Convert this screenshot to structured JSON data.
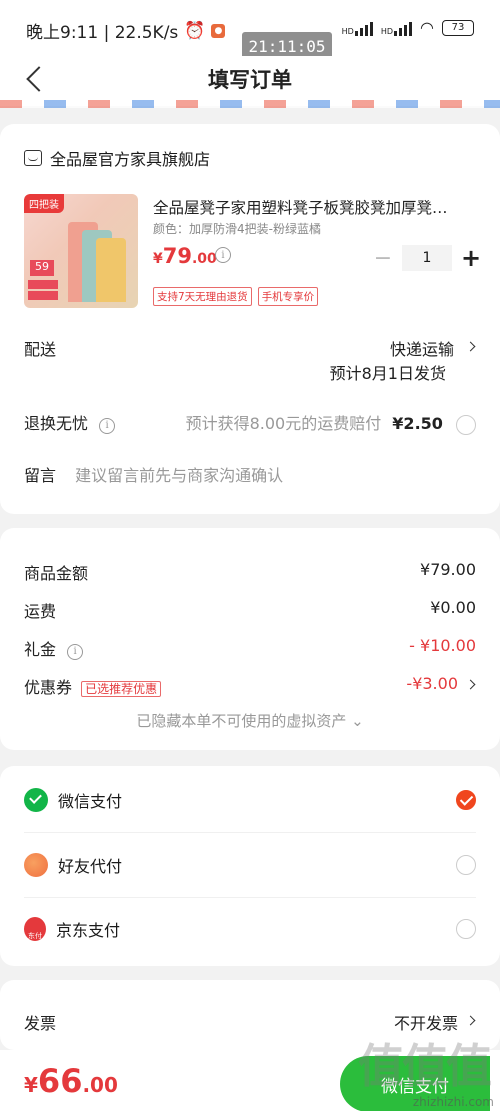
{
  "status_bar": {
    "time_speed": "晚上9:11 | 22.5K/s",
    "overlay_time": "21:11:05",
    "battery": "73",
    "net1": "HD",
    "net2": "HD"
  },
  "header": {
    "title": "填写订单"
  },
  "shop": {
    "name": "全品屋官方家具旗舰店"
  },
  "product": {
    "image_tag": "四把装",
    "image_price": "59",
    "name": "全品屋凳子家用塑料凳子板凳胶凳加厚凳…",
    "spec": "颜色：加厚防滑4把装-粉绿蓝橘",
    "price_currency": "¥",
    "price_int": "79",
    "price_dec": ".00",
    "quantity": "1",
    "tags": [
      "支持7天无理由退货",
      "手机专享价"
    ]
  },
  "delivery": {
    "label": "配送",
    "method": "快递运输",
    "estimate": "预计8月1日发货"
  },
  "return_worry_free": {
    "label": "退换无忧",
    "desc": "预计获得8.00元的运费赔付",
    "price": "¥2.50"
  },
  "message": {
    "label": "留言",
    "placeholder": "建议留言前先与商家沟通确认"
  },
  "summary": {
    "goods_label": "商品金额",
    "goods_value": "¥79.00",
    "shipping_label": "运费",
    "shipping_value": "¥0.00",
    "gift_label": "礼金",
    "gift_value": "- ¥10.00",
    "coupon_label": "优惠券",
    "coupon_tag": "已选推荐优惠",
    "coupon_value": "-¥3.00",
    "hidden_assets": "已隐藏本单不可使用的虚拟资产 ⌄"
  },
  "payment": {
    "methods": [
      {
        "label": "微信支付",
        "selected": true
      },
      {
        "label": "好友代付",
        "selected": false
      },
      {
        "label": "京东支付",
        "selected": false
      }
    ],
    "jd_icon_text": "东付"
  },
  "invoice": {
    "label": "发票",
    "value": "不开发票"
  },
  "bottom": {
    "currency": "¥",
    "total_int": "66",
    "total_dec": ".00",
    "pay_button": "微信支付",
    "watermark": "zhizhizhi.com",
    "watermark_big": "值值值"
  },
  "colors": {
    "accent": "#e4393c",
    "wechat": "#2bbd3c"
  }
}
